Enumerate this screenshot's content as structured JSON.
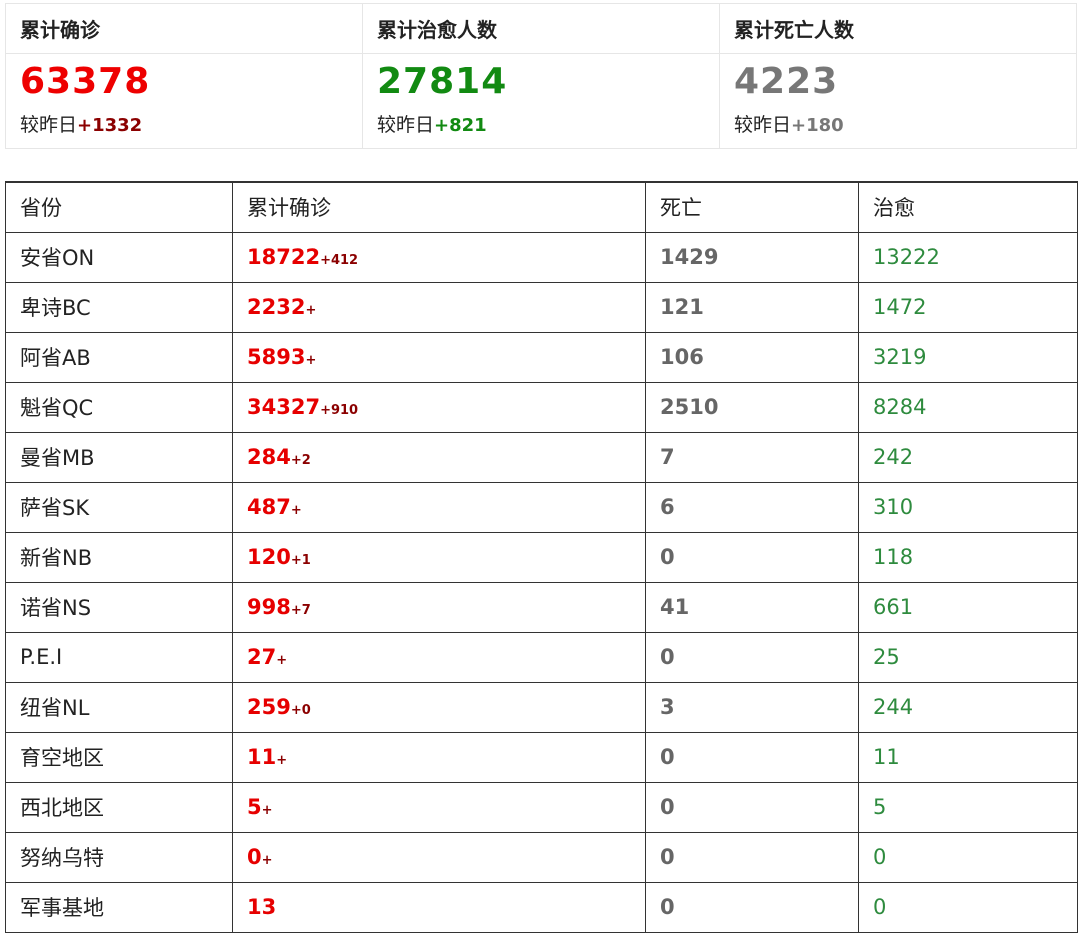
{
  "summary": [
    {
      "label": "累计确诊",
      "value": "63378",
      "delta_prefix": "较昨日",
      "delta": "+1332",
      "value_color": "#ee0000",
      "delta_color": "#8b0000"
    },
    {
      "label": "累计治愈人数",
      "value": "27814",
      "delta_prefix": "较昨日",
      "delta": "+821",
      "value_color": "#128a12",
      "delta_color": "#128a12"
    },
    {
      "label": "累计死亡人数",
      "value": "4223",
      "delta_prefix": "较昨日",
      "delta": "+180",
      "value_color": "#777777",
      "delta_color": "#777777"
    }
  ],
  "table": {
    "headers": [
      "省份",
      "累计确诊",
      "死亡",
      "治愈"
    ],
    "rows": [
      {
        "province": "安省ON",
        "confirmed": "18722",
        "increase": "+412",
        "deaths": "1429",
        "cured": "13222"
      },
      {
        "province": "卑诗BC",
        "confirmed": "2232",
        "increase": "+",
        "deaths": "121",
        "cured": "1472"
      },
      {
        "province": "阿省AB",
        "confirmed": "5893",
        "increase": "+",
        "deaths": "106",
        "cured": "3219"
      },
      {
        "province": "魁省QC",
        "confirmed": "34327",
        "increase": "+910",
        "deaths": "2510",
        "cured": "8284"
      },
      {
        "province": "曼省MB",
        "confirmed": "284",
        "increase": "+2",
        "deaths": "7",
        "cured": "242"
      },
      {
        "province": "萨省SK",
        "confirmed": "487",
        "increase": "+",
        "deaths": "6",
        "cured": "310"
      },
      {
        "province": "新省NB",
        "confirmed": "120",
        "increase": "+1",
        "deaths": "0",
        "cured": "118"
      },
      {
        "province": "诺省NS",
        "confirmed": "998",
        "increase": "+7",
        "deaths": "41",
        "cured": "661"
      },
      {
        "province": "P.E.I",
        "confirmed": "27",
        "increase": "+",
        "deaths": "0",
        "cured": "25"
      },
      {
        "province": "纽省NL",
        "confirmed": "259",
        "increase": "+0",
        "deaths": "3",
        "cured": "244"
      },
      {
        "province": "育空地区",
        "confirmed": "11",
        "increase": "+",
        "deaths": "0",
        "cured": "11"
      },
      {
        "province": "西北地区",
        "confirmed": "5",
        "increase": "+",
        "deaths": "0",
        "cured": "5"
      },
      {
        "province": "努纳乌特",
        "confirmed": "0",
        "increase": "+",
        "deaths": "0",
        "cured": "0"
      },
      {
        "province": "军事基地",
        "confirmed": "13",
        "increase": "",
        "deaths": "0",
        "cured": "0"
      }
    ]
  }
}
